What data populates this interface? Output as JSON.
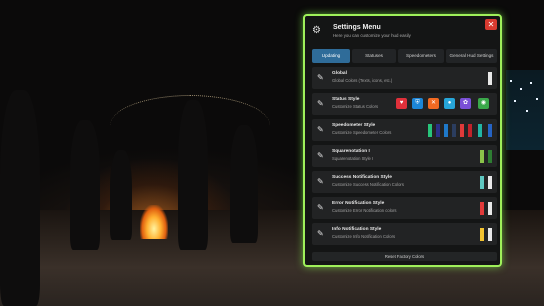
{
  "window": {
    "title": "Settings Menu",
    "subtitle": "Here you can customize your hud easily",
    "close_label": "✕"
  },
  "tabs": [
    {
      "label": "Updating"
    },
    {
      "label": "Statuses"
    },
    {
      "label": "Speedometers"
    },
    {
      "label": "General Hud Settings"
    }
  ],
  "rows": [
    {
      "name": "Global",
      "desc": "Global Colors (Texts, icons, etc.)",
      "swatches": [
        "#e8e8e8"
      ]
    },
    {
      "name": "Status Style",
      "desc": "Customize Status Colors",
      "icon_buttons": [
        {
          "icon": "heart-icon",
          "glyph": "♥",
          "color": "#e0303a"
        },
        {
          "icon": "shield-icon",
          "glyph": "⛨",
          "color": "#1c86d8"
        },
        {
          "icon": "fork-knife-icon",
          "glyph": "✕",
          "color": "#f26a22"
        },
        {
          "icon": "drop-icon",
          "glyph": "●",
          "color": "#27a6d9"
        },
        {
          "icon": "brain-icon",
          "glyph": "✿",
          "color": "#7a4fd6"
        },
        {
          "icon": "lung-icon",
          "glyph": "◉",
          "color": "#3aa84a"
        }
      ]
    },
    {
      "name": "Speedometer Style",
      "desc": "Customize Speedometer Colors",
      "swatches": [
        "#28c47a",
        "#2b2f86",
        "#1f79c9",
        "#2b3d5f",
        "#e03a3a",
        "#c2222a",
        "#22b5a4",
        "#2563c4"
      ]
    },
    {
      "name": "Squarenotation I",
      "desc": "Squarenotation Style I",
      "swatches": [
        "#8bc34a",
        "#2e7d32"
      ]
    },
    {
      "name": "Success Notification Style",
      "desc": "Customize Success Notification Colors",
      "swatches": [
        "#5ec7c0",
        "#e8e8e8"
      ]
    },
    {
      "name": "Error Notification Style",
      "desc": "Customize Error Notification colors",
      "swatches": [
        "#e23a3a",
        "#e8e8e8"
      ]
    },
    {
      "name": "Info Notification Style",
      "desc": "Customize Info Notification Colors",
      "swatches": [
        "#f2c230",
        "#e8e8e8"
      ]
    }
  ],
  "footer": {
    "label": "Reset Factory Colors"
  },
  "colors": {
    "accent_border": "#9ff05a",
    "active_tab": "#2f6c99",
    "close": "#d83a2f"
  }
}
